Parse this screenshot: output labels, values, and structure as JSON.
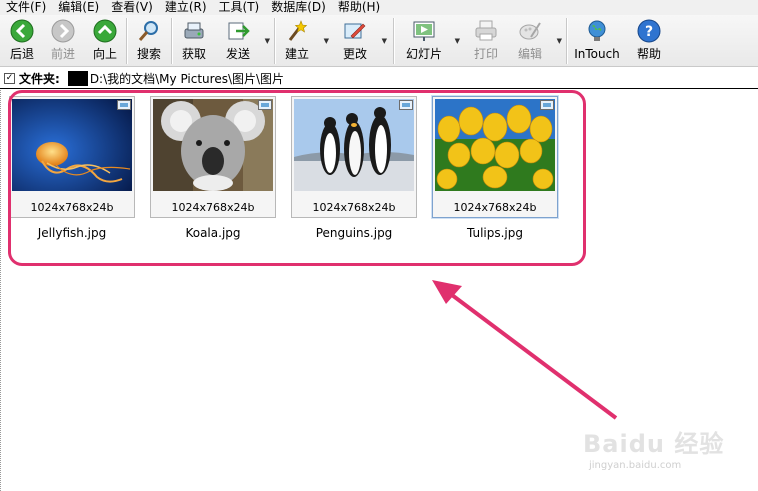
{
  "menu": [
    "文件(F)",
    "编辑(E)",
    "查看(V)",
    "建立(R)",
    "工具(T)",
    "数据库(D)",
    "帮助(H)"
  ],
  "toolbar": {
    "back": "后退",
    "forward": "前进",
    "up": "向上",
    "search": "搜索",
    "acquire": "获取",
    "send": "发送",
    "create": "建立",
    "modify": "更改",
    "slideshow": "幻灯片",
    "print": "打印",
    "edit": "编辑",
    "intouch": "InTouch",
    "help": "帮助"
  },
  "address": {
    "checked": true,
    "label": "文件夹:",
    "path": "D:\\我的文档\\My Pictures\\图片\\图片"
  },
  "thumbnails": [
    {
      "dims": "1024x768x24b",
      "filename": "Jellyfish.jpg",
      "selected": false
    },
    {
      "dims": "1024x768x24b",
      "filename": "Koala.jpg",
      "selected": false
    },
    {
      "dims": "1024x768x24b",
      "filename": "Penguins.jpg",
      "selected": false
    },
    {
      "dims": "1024x768x24b",
      "filename": "Tulips.jpg",
      "selected": true
    }
  ],
  "colors": {
    "highlight": "#e0306e",
    "selection": "#7da2ce"
  },
  "watermark": {
    "main": "Baidu 经验",
    "sub": "jingyan.baidu.com"
  }
}
